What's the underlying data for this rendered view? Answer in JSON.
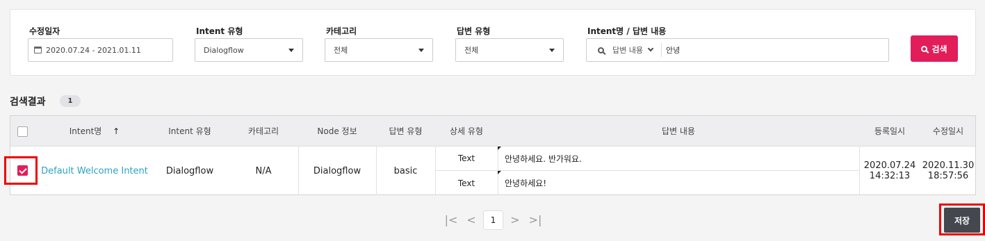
{
  "filters": {
    "date_label": "수정일자",
    "date_value": "2020.07.24 - 2021.01.11",
    "intent_type_label": "Intent 유형",
    "intent_type_value": "Dialogflow",
    "category_label": "카테고리",
    "category_value": "전체",
    "answer_type_label": "답변 유형",
    "answer_type_value": "전체",
    "search_label": "Intent명 / 답변 내용",
    "search_target": "답변 내용",
    "search_value": "안녕",
    "search_button": "검색"
  },
  "results": {
    "title": "검색결과",
    "count": "1",
    "columns": [
      "Intent명",
      "Intent 유형",
      "카테고리",
      "Node 정보",
      "답변 유형",
      "상세 유형",
      "답변 내용",
      "등록일시",
      "수정일시"
    ],
    "sort_indicator": "↑",
    "row": {
      "checked": true,
      "intent_name": "Default Welcome Intent",
      "intent_type": "Dialogflow",
      "category": "N/A",
      "node_info": "Dialogflow",
      "answer_type": "basic",
      "details": [
        {
          "detail_type": "Text",
          "answer": "안녕하세요. 반가워요."
        },
        {
          "detail_type": "Text",
          "answer": "안녕하세요!"
        }
      ],
      "registered_date": "2020.07.24",
      "registered_time": "14:32:13",
      "modified_date": "2020.11.30",
      "modified_time": "18:57:56"
    }
  },
  "pagination": {
    "first": "|<",
    "prev": "<",
    "current": "1",
    "next": ">",
    "last": ">|"
  },
  "save_button": "저장",
  "colors": {
    "accent": "#e21d5a",
    "link": "#2aa3c4",
    "highlight": "#ee0000",
    "save": "#44474d"
  }
}
